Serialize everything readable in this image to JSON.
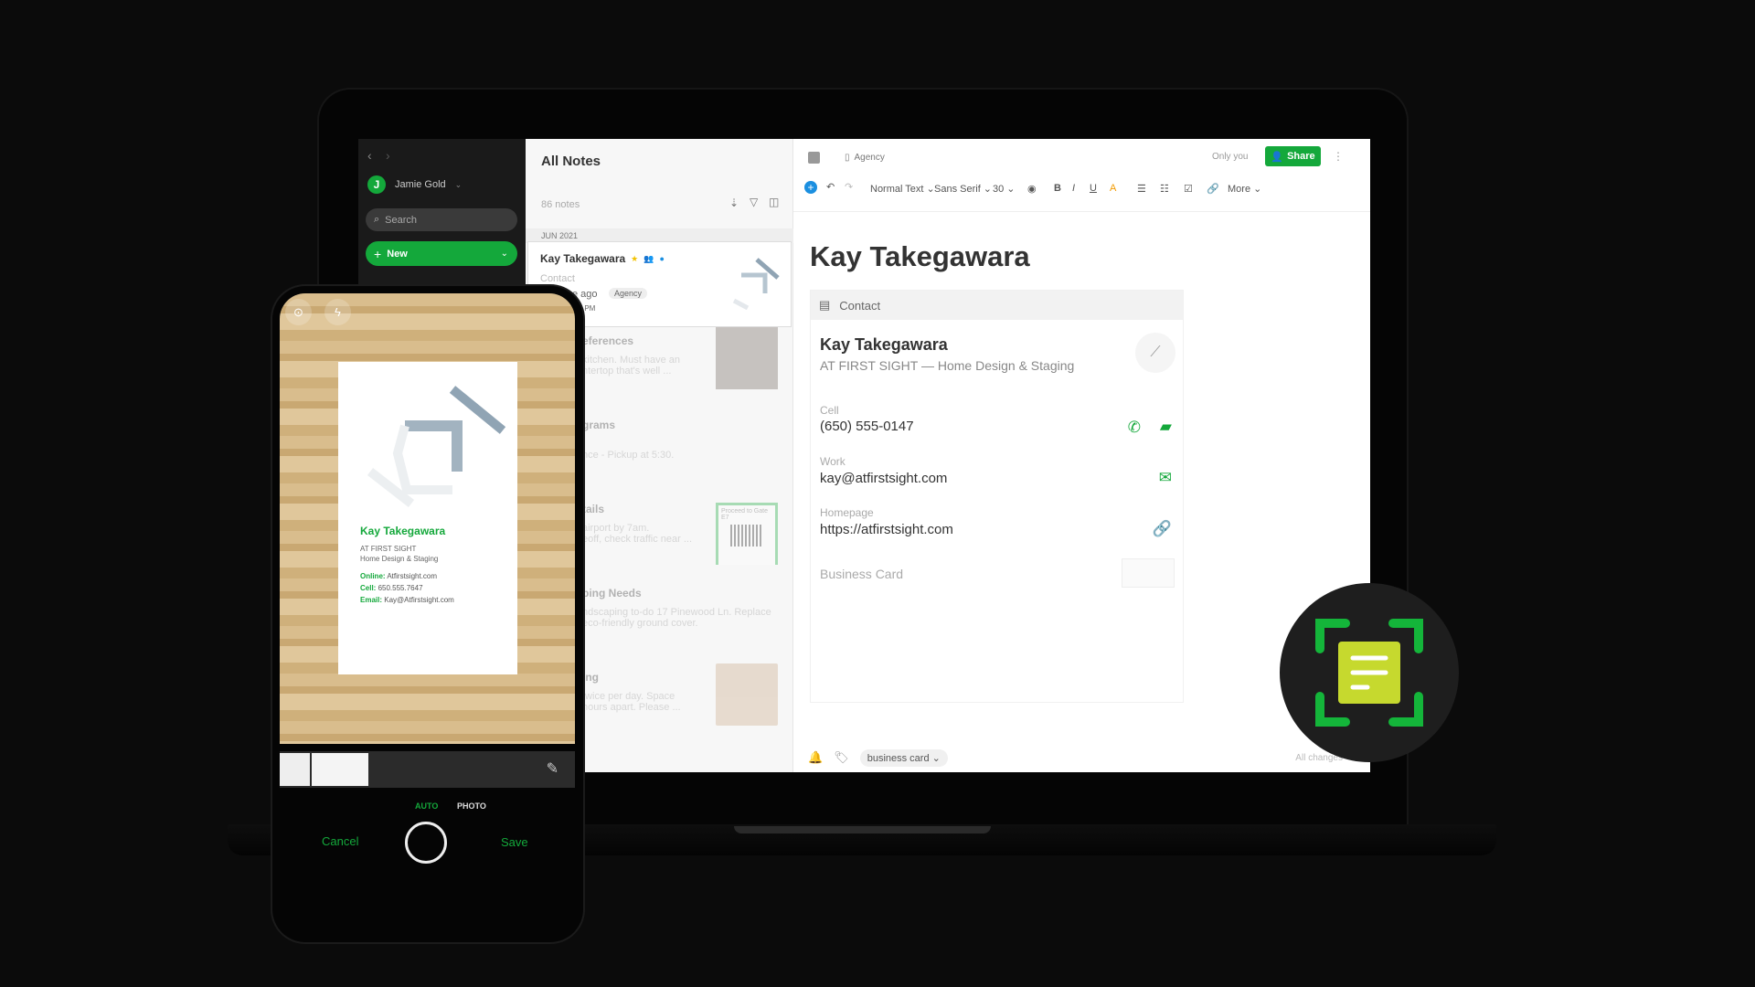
{
  "sidebar": {
    "user": "Jamie Gold",
    "avatar_letter": "J",
    "search_placeholder": "Search",
    "new_label": "New"
  },
  "notelist": {
    "title": "All Notes",
    "count": "86 notes",
    "month": "JUN 2021",
    "selected": {
      "title": "Kay Takegawara",
      "subtitle": "Contact",
      "time": "e ago",
      "tag": "Agency",
      "date": ":30 PM"
    },
    "faded": [
      {
        "title": "eferences",
        "l1": "kitchen. Must have an",
        "l2": "ntertop that's well ..."
      },
      {
        "title": "grams",
        "l1": "nce - Pickup at 5:30."
      },
      {
        "title": "tails",
        "l1": "airport by 7am.",
        "l2": "eoff, check traffic near ..."
      },
      {
        "title": "ping Needs",
        "l1": "ndscaping to-do 17 Pinewood Ln. Replace",
        "l2": "eco-friendly ground cover."
      },
      {
        "title": "ing",
        "l1": "twice per day. Space",
        "l2": "hours apart. Please ..."
      }
    ],
    "qr_text": "Proceed to Gate E7"
  },
  "editor": {
    "notebook": "Agency",
    "sharing": "Only you",
    "share_label": "Share",
    "toolbar": {
      "style": "Normal Text",
      "font": "Sans Serif",
      "size": "30",
      "more": "More"
    },
    "title": "Kay Takegawara",
    "contact": {
      "header": "Contact",
      "name": "Kay Takegawara",
      "company": "AT FIRST SIGHT — Home Design & Staging",
      "cell_label": "Cell",
      "cell": "(650) 555-0147",
      "work_label": "Work",
      "work": "kay@atfirstsight.com",
      "home_label": "Homepage",
      "home": "https://atfirstsight.com",
      "card_label": "Business Card"
    },
    "tag": "business card",
    "status": "All changes"
  },
  "phone": {
    "card": {
      "name": "Kay Takegawara",
      "company": "AT FIRST SIGHT",
      "tagline": "Home Design & Staging",
      "online_label": "Online:",
      "online": "Atfirstsight.com",
      "cell_label": "Cell:",
      "cell": "650.555.7647",
      "email_label": "Email:",
      "email": "Kay@Atfirstsight.com"
    },
    "mode_auto": "AUTO",
    "mode_photo": "PHOTO",
    "cancel": "Cancel",
    "save": "Save"
  },
  "colors": {
    "brand_green": "#14a83b",
    "badge_doc": "#c6d92e"
  }
}
